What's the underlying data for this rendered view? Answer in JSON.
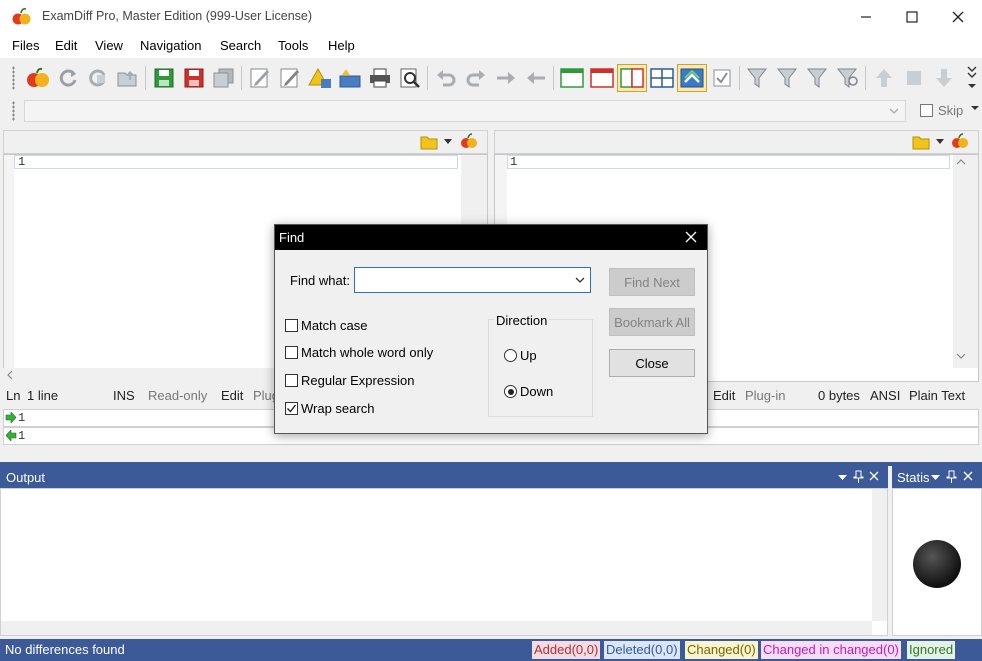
{
  "window": {
    "title": "ExamDiff Pro, Master Edition (999-User License)"
  },
  "menu": [
    "Files",
    "Edit",
    "View",
    "Navigation",
    "Search",
    "Tools",
    "Help"
  ],
  "skip_label": "Skip",
  "left_pane": {
    "line": "1"
  },
  "right_pane": {
    "line": "1"
  },
  "status_left": {
    "ln": "Ln",
    "lines": "1 line",
    "ins": "INS",
    "readonly": "Read-only",
    "edit": "Edit",
    "plug": "Plug"
  },
  "status_right": {
    "edit": "Edit",
    "plugin": "Plug-in",
    "bytes": "0 bytes",
    "encoding": "ANSI",
    "filetype": "Plain Text"
  },
  "compare_rows": [
    "1",
    "1"
  ],
  "output": {
    "title": "Output"
  },
  "statistics": {
    "title": "Statis"
  },
  "statusbar": {
    "message": "No differences found",
    "added": "Added(0,0)",
    "deleted": "Deleted(0,0)",
    "changed": "Changed(0)",
    "changed_in_changed": "Changed in changed(0)",
    "ignored": "Ignored"
  },
  "colors": {
    "accent": "#3c5a98",
    "added": "#f3dde3",
    "deleted": "#dde6f5",
    "changed": "#fbf5cf",
    "cic": "#f8ddf6",
    "ignored": "#e4f3e4"
  },
  "find_dialog": {
    "title": "Find",
    "find_what_label": "Find what:",
    "find_what_value": "",
    "match_case": {
      "label": "Match case",
      "checked": false
    },
    "match_whole_word": {
      "label": "Match whole word only",
      "checked": false
    },
    "regex": {
      "label": "Regular Expression",
      "checked": false
    },
    "wrap_search": {
      "label": "Wrap search",
      "checked": true
    },
    "direction": {
      "label": "Direction",
      "up": "Up",
      "down": "Down",
      "selected": "Down"
    },
    "buttons": {
      "find_next": "Find Next",
      "bookmark_all": "Bookmark All",
      "close": "Close"
    }
  }
}
